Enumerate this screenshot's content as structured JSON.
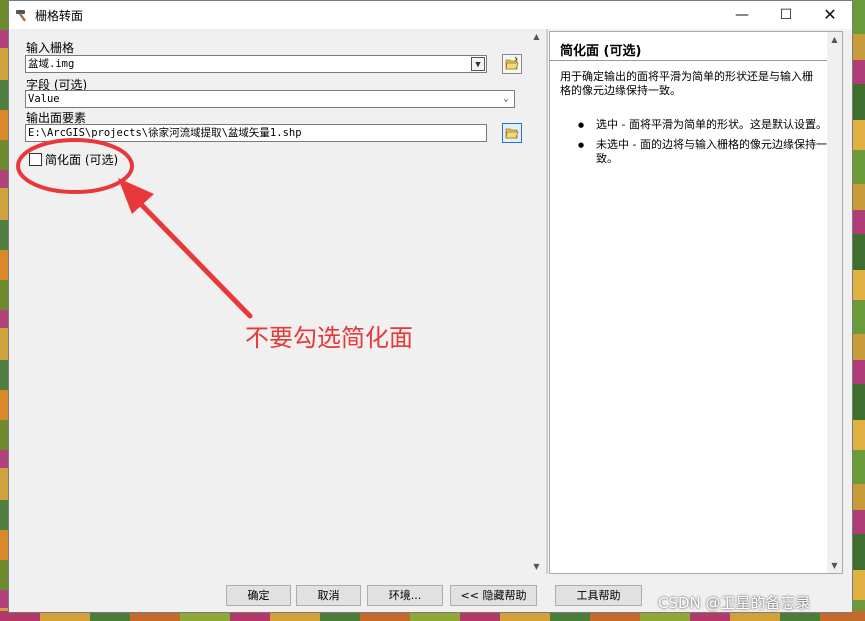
{
  "window": {
    "title": "栅格转面",
    "controls": {
      "minimize": "—",
      "maximize": "☐",
      "close": "✕"
    }
  },
  "form": {
    "input_raster": {
      "label": "输入栅格",
      "value": "盆域.img"
    },
    "field": {
      "label": "字段 (可选)",
      "value": "Value"
    },
    "output_features": {
      "label": "输出面要素",
      "value": "E:\\ArcGIS\\projects\\徐家河流域提取\\盆域矢量1.shp"
    },
    "simplify": {
      "label": "简化面 (可选)",
      "checked": false
    }
  },
  "help": {
    "title": "简化面 (可选)",
    "description": "用于确定输出的面将平滑为简单的形状还是与输入栅格的像元边缘保持一致。",
    "items": [
      "选中 - 面将平滑为简单的形状。这是默认设置。",
      "未选中 - 面的边将与输入栅格的像元边缘保持一致。"
    ]
  },
  "buttons": {
    "ok": "确定",
    "cancel": "取消",
    "environments": "环境...",
    "hide_help": "<< 隐藏帮助",
    "tool_help": "工具帮助"
  },
  "annotation": {
    "text": "不要勾选简化面",
    "color": "#e8383a"
  },
  "watermark": "CSDN @卫星的备忘录"
}
